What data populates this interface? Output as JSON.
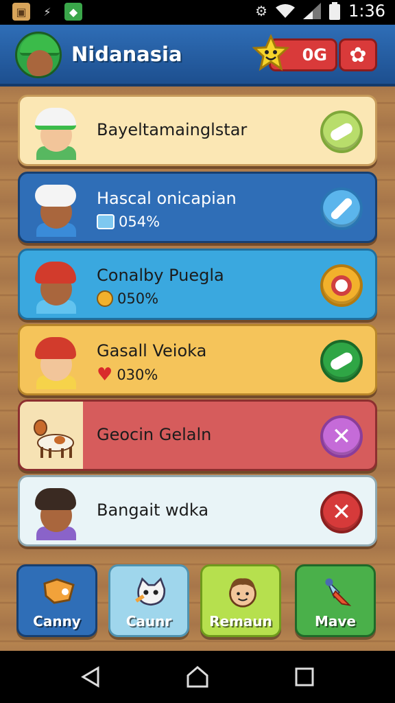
{
  "status_bar": {
    "time": "1:36",
    "left_icons": [
      "dice-icon",
      "usb-icon",
      "app-icon"
    ],
    "right_icons": [
      "gear-icon",
      "wifi-icon",
      "signal-icon",
      "battery-icon"
    ]
  },
  "header": {
    "title": "Nidanasia",
    "score": "0G"
  },
  "rows": [
    {
      "name": "Bayeltamainglstar",
      "stat": "",
      "bg": "#fbe7b4",
      "action": "confirm",
      "action_color": "#b8dd6b"
    },
    {
      "name": "Hascal onicapian",
      "stat": "054%",
      "bg": "#2f6eb7",
      "action": "edit",
      "action_color": "#5bb5ec"
    },
    {
      "name": "Conalby Puegla",
      "stat": "050%",
      "bg": "#3aa8df",
      "action": "target",
      "action_color": "#f2b12c"
    },
    {
      "name": "Gasall Veioka",
      "stat": "030%",
      "bg": "#f5c45a",
      "action": "confirm",
      "action_color": "#2fa645"
    },
    {
      "name": "Geocin Gelaln",
      "stat": "",
      "bg": "#d65c5c",
      "action": "remove",
      "action_color": "#c56bd8"
    },
    {
      "name": "Bangait wdka",
      "stat": "",
      "bg": "#e9f4f7",
      "action": "remove",
      "action_color": "#d63a3a"
    }
  ],
  "tabs": [
    {
      "label": "Canny",
      "color": "#2f6eb7"
    },
    {
      "label": "Caunr",
      "color": "#9fd6ec"
    },
    {
      "label": "Remaun",
      "color": "#b6e04e"
    },
    {
      "label": "Mave",
      "color": "#4ab04a"
    }
  ],
  "nav": [
    "back-icon",
    "home-icon",
    "recents-icon"
  ]
}
